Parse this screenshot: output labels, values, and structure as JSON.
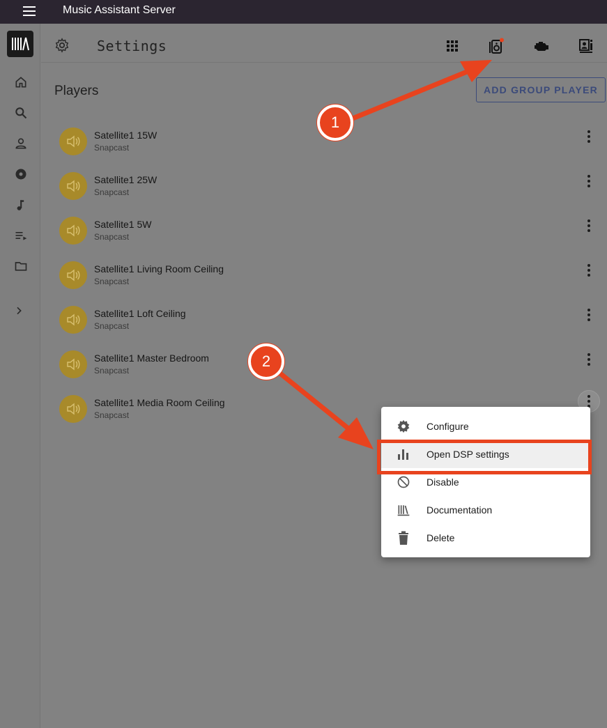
{
  "app": {
    "title": "Music Assistant Server"
  },
  "header": {
    "settings_label": "Settings"
  },
  "toolbar": {
    "icons": [
      "grid-icon",
      "speaker-icon",
      "engine-icon",
      "info-panel-icon"
    ]
  },
  "players_section": {
    "title": "Players",
    "add_button": "ADD GROUP PLAYER"
  },
  "players": [
    {
      "name": "Satellite1 15W",
      "provider": "Snapcast"
    },
    {
      "name": "Satellite1 25W",
      "provider": "Snapcast"
    },
    {
      "name": "Satellite1 5W",
      "provider": "Snapcast"
    },
    {
      "name": "Satellite1 Living Room Ceiling",
      "provider": "Snapcast"
    },
    {
      "name": "Satellite1 Loft Ceiling",
      "provider": "Snapcast"
    },
    {
      "name": "Satellite1 Master Bedroom",
      "provider": "Snapcast"
    },
    {
      "name": "Satellite1 Media Room Ceiling",
      "provider": "Snapcast"
    }
  ],
  "context_menu": {
    "items": [
      {
        "label": "Configure",
        "icon": "gear-icon"
      },
      {
        "label": "Open DSP settings",
        "icon": "bar-chart-icon"
      },
      {
        "label": "Disable",
        "icon": "block-icon"
      },
      {
        "label": "Documentation",
        "icon": "library-icon"
      },
      {
        "label": "Delete",
        "icon": "trash-icon"
      }
    ]
  },
  "annotations": {
    "step1": "1",
    "step2": "2"
  },
  "colors": {
    "accent": "#e8431e",
    "topbar": "#2b2530",
    "avatar": "#a88a2a"
  }
}
